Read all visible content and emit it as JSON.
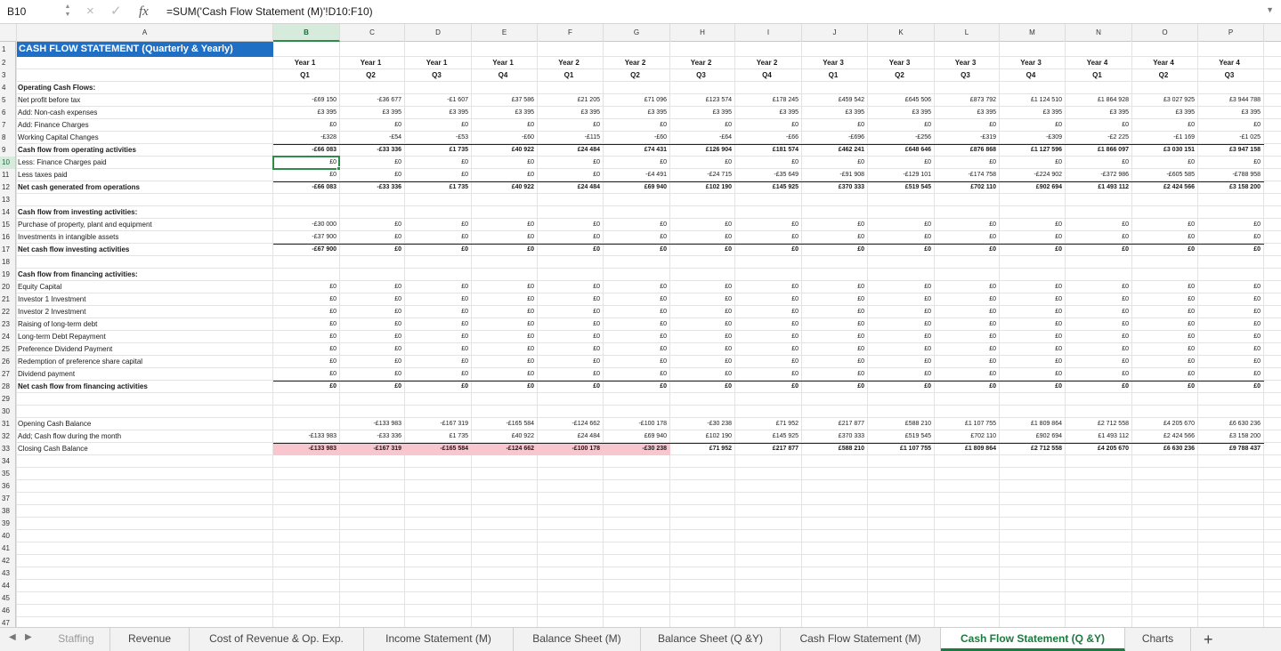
{
  "formula_bar": {
    "name_box": "B10",
    "cancel_icon": "×",
    "confirm_icon": "✓",
    "fx_label": "fx",
    "formula": "=SUM('Cash Flow Statement (M)'!D10:F10)"
  },
  "columns": [
    "A",
    "B",
    "C",
    "D",
    "E",
    "F",
    "G",
    "H",
    "I",
    "J",
    "K",
    "L",
    "M",
    "N",
    "O",
    "P"
  ],
  "title": "CASH FLOW STATEMENT (Quarterly & Yearly)",
  "header_years": [
    "Year 1",
    "Year 1",
    "Year 1",
    "Year 1",
    "Year 2",
    "Year 2",
    "Year 2",
    "Year 2",
    "Year 3",
    "Year 3",
    "Year 3",
    "Year 3",
    "Year 4",
    "Year 4",
    "Year 4"
  ],
  "header_quarters": [
    "Q1",
    "Q2",
    "Q3",
    "Q4",
    "Q1",
    "Q2",
    "Q3",
    "Q4",
    "Q1",
    "Q2",
    "Q3",
    "Q4",
    "Q1",
    "Q2",
    "Q3"
  ],
  "rows": [
    {
      "n": "4",
      "label": "Operating Cash Flows:",
      "bold": true,
      "values": []
    },
    {
      "n": "5",
      "label": "Net profit before tax",
      "bold": false,
      "values": [
        "-£69 150",
        "-£36 677",
        "-£1 607",
        "£37 586",
        "£21 205",
        "£71 096",
        "£123 574",
        "£178 245",
        "£459 542",
        "£645 506",
        "£873 792",
        "£1 124 510",
        "£1 864 928",
        "£3 027 925",
        "£3 944 788"
      ]
    },
    {
      "n": "6",
      "label": "Add: Non-cash expenses",
      "bold": false,
      "values": [
        "£3 395",
        "£3 395",
        "£3 395",
        "£3 395",
        "£3 395",
        "£3 395",
        "£3 395",
        "£3 395",
        "£3 395",
        "£3 395",
        "£3 395",
        "£3 395",
        "£3 395",
        "£3 395",
        "£3 395"
      ]
    },
    {
      "n": "7",
      "label": "Add: Finance Charges",
      "bold": false,
      "values": [
        "£0",
        "£0",
        "£0",
        "£0",
        "£0",
        "£0",
        "£0",
        "£0",
        "£0",
        "£0",
        "£0",
        "£0",
        "£0",
        "£0",
        "£0"
      ]
    },
    {
      "n": "8",
      "label": "Working Capital Changes",
      "bold": false,
      "values": [
        "-£328",
        "-£54",
        "-£53",
        "-£60",
        "-£115",
        "-£60",
        "-£64",
        "-£66",
        "-£696",
        "-£256",
        "-£319",
        "-£309",
        "-£2 225",
        "-£1 169",
        "-£1 025"
      ]
    },
    {
      "n": "9",
      "label": "Cash flow from operating activities",
      "bold": true,
      "values": [
        "-£66 083",
        "-£33 336",
        "£1 735",
        "£40 922",
        "£24 484",
        "£74 431",
        "£126 904",
        "£181 574",
        "£462 241",
        "£648 646",
        "£876 868",
        "£1 127 596",
        "£1 866 097",
        "£3 030 151",
        "£3 947 158"
      ]
    },
    {
      "n": "10",
      "label": "Less: Finance Charges paid",
      "bold": false,
      "values": [
        "£0",
        "£0",
        "£0",
        "£0",
        "£0",
        "£0",
        "£0",
        "£0",
        "£0",
        "£0",
        "£0",
        "£0",
        "£0",
        "£0",
        "£0"
      ]
    },
    {
      "n": "11",
      "label": "Less  taxes paid",
      "bold": false,
      "values": [
        "£0",
        "£0",
        "£0",
        "£0",
        "£0",
        "-£4 491",
        "-£24 715",
        "-£35 649",
        "-£91 908",
        "-£129 101",
        "-£174 758",
        "-£224 902",
        "-£372 986",
        "-£605 585",
        "-£788 958"
      ]
    },
    {
      "n": "12",
      "label": "Net cash generated from operations",
      "bold": true,
      "values": [
        "-£66 083",
        "-£33 336",
        "£1 735",
        "£40 922",
        "£24 484",
        "£69 940",
        "£102 190",
        "£145 925",
        "£370 333",
        "£519 545",
        "£702 110",
        "£902 694",
        "£1 493 112",
        "£2 424 566",
        "£3 158 200"
      ]
    },
    {
      "n": "13",
      "label": "",
      "bold": false,
      "values": []
    },
    {
      "n": "14",
      "label": "Cash flow from investing activities:",
      "bold": true,
      "values": []
    },
    {
      "n": "15",
      "label": "Purchase of property, plant and equipment",
      "bold": false,
      "values": [
        "-£30 000",
        "£0",
        "£0",
        "£0",
        "£0",
        "£0",
        "£0",
        "£0",
        "£0",
        "£0",
        "£0",
        "£0",
        "£0",
        "£0",
        "£0"
      ]
    },
    {
      "n": "16",
      "label": "Investments in intangible assets",
      "bold": false,
      "values": [
        "-£37 900",
        "£0",
        "£0",
        "£0",
        "£0",
        "£0",
        "£0",
        "£0",
        "£0",
        "£0",
        "£0",
        "£0",
        "£0",
        "£0",
        "£0"
      ]
    },
    {
      "n": "17",
      "label": "Net cash flow investing activities",
      "bold": true,
      "values": [
        "-£67 900",
        "£0",
        "£0",
        "£0",
        "£0",
        "£0",
        "£0",
        "£0",
        "£0",
        "£0",
        "£0",
        "£0",
        "£0",
        "£0",
        "£0"
      ]
    },
    {
      "n": "18",
      "label": "",
      "bold": false,
      "values": []
    },
    {
      "n": "19",
      "label": "Cash flow from financing activities:",
      "bold": true,
      "values": []
    },
    {
      "n": "20",
      "label": "Equity Capital",
      "bold": false,
      "values": [
        "£0",
        "£0",
        "£0",
        "£0",
        "£0",
        "£0",
        "£0",
        "£0",
        "£0",
        "£0",
        "£0",
        "£0",
        "£0",
        "£0",
        "£0"
      ]
    },
    {
      "n": "21",
      "label": "Investor 1 Investment",
      "bold": false,
      "values": [
        "£0",
        "£0",
        "£0",
        "£0",
        "£0",
        "£0",
        "£0",
        "£0",
        "£0",
        "£0",
        "£0",
        "£0",
        "£0",
        "£0",
        "£0"
      ]
    },
    {
      "n": "22",
      "label": "Investor 2 Investment",
      "bold": false,
      "values": [
        "£0",
        "£0",
        "£0",
        "£0",
        "£0",
        "£0",
        "£0",
        "£0",
        "£0",
        "£0",
        "£0",
        "£0",
        "£0",
        "£0",
        "£0"
      ]
    },
    {
      "n": "23",
      "label": "Raising of long-term debt",
      "bold": false,
      "values": [
        "£0",
        "£0",
        "£0",
        "£0",
        "£0",
        "£0",
        "£0",
        "£0",
        "£0",
        "£0",
        "£0",
        "£0",
        "£0",
        "£0",
        "£0"
      ]
    },
    {
      "n": "24",
      "label": "Long-term Debt Repayment",
      "bold": false,
      "values": [
        "£0",
        "£0",
        "£0",
        "£0",
        "£0",
        "£0",
        "£0",
        "£0",
        "£0",
        "£0",
        "£0",
        "£0",
        "£0",
        "£0",
        "£0"
      ]
    },
    {
      "n": "25",
      "label": "Preference Dividend Payment",
      "bold": false,
      "values": [
        "£0",
        "£0",
        "£0",
        "£0",
        "£0",
        "£0",
        "£0",
        "£0",
        "£0",
        "£0",
        "£0",
        "£0",
        "£0",
        "£0",
        "£0"
      ]
    },
    {
      "n": "26",
      "label": "Redemption of preference share capital",
      "bold": false,
      "values": [
        "£0",
        "£0",
        "£0",
        "£0",
        "£0",
        "£0",
        "£0",
        "£0",
        "£0",
        "£0",
        "£0",
        "£0",
        "£0",
        "£0",
        "£0"
      ]
    },
    {
      "n": "27",
      "label": "Dividend payment",
      "bold": false,
      "values": [
        "£0",
        "£0",
        "£0",
        "£0",
        "£0",
        "£0",
        "£0",
        "£0",
        "£0",
        "£0",
        "£0",
        "£0",
        "£0",
        "£0",
        "£0"
      ]
    },
    {
      "n": "28",
      "label": "Net cash flow from financing activities",
      "bold": true,
      "values": [
        "£0",
        "£0",
        "£0",
        "£0",
        "£0",
        "£0",
        "£0",
        "£0",
        "£0",
        "£0",
        "£0",
        "£0",
        "£0",
        "£0",
        "£0"
      ]
    },
    {
      "n": "29",
      "label": "",
      "bold": false,
      "values": []
    },
    {
      "n": "30",
      "label": "",
      "bold": false,
      "values": []
    },
    {
      "n": "31",
      "label": "Opening Cash Balance",
      "bold": false,
      "values": [
        "",
        "-£133 983",
        "-£167 319",
        "-£165 584",
        "-£124 662",
        "-£100 178",
        "-£30 238",
        "£71 952",
        "£217 877",
        "£588 210",
        "£1 107 755",
        "£1 809 864",
        "£2 712 558",
        "£4 205 670",
        "£6 630 236"
      ]
    },
    {
      "n": "32",
      "label": "Add; Cash flow during the month",
      "bold": false,
      "values": [
        "-£133 983",
        "-£33 336",
        "£1 735",
        "£40 922",
        "£24 484",
        "£69 940",
        "£102 190",
        "£145 925",
        "£370 333",
        "£519 545",
        "£702 110",
        "£902 694",
        "£1 493 112",
        "£2 424 566",
        "£3 158 200"
      ]
    },
    {
      "n": "33",
      "label": "Closing Cash Balance",
      "bold": false,
      "closing": true,
      "values": [
        "-£133 983",
        "-£167 319",
        "-£165 584",
        "-£124 662",
        "-£100 178",
        "-£30 238",
        "£71 952",
        "£217 877",
        "£588 210",
        "£1 107 755",
        "£1 809 864",
        "£2 712 558",
        "£4 205 670",
        "£6 630 236",
        "£9 788 437"
      ]
    },
    {
      "n": "34",
      "label": "",
      "bold": false,
      "values": []
    },
    {
      "n": "35",
      "label": "",
      "bold": false,
      "values": []
    },
    {
      "n": "36",
      "label": "",
      "bold": false,
      "values": []
    },
    {
      "n": "37",
      "label": "",
      "bold": false,
      "values": []
    },
    {
      "n": "38",
      "label": "",
      "bold": false,
      "values": []
    },
    {
      "n": "39",
      "label": "",
      "bold": false,
      "values": []
    },
    {
      "n": "40",
      "label": "",
      "bold": false,
      "values": []
    },
    {
      "n": "41",
      "label": "",
      "bold": false,
      "values": []
    },
    {
      "n": "42",
      "label": "",
      "bold": false,
      "values": []
    },
    {
      "n": "43",
      "label": "",
      "bold": false,
      "values": []
    },
    {
      "n": "44",
      "label": "",
      "bold": false,
      "values": []
    },
    {
      "n": "45",
      "label": "",
      "bold": false,
      "values": []
    },
    {
      "n": "46",
      "label": "",
      "bold": false,
      "values": []
    },
    {
      "n": "47",
      "label": "",
      "bold": false,
      "values": []
    }
  ],
  "closing_negative_color": "#f7c6cf",
  "sheet_tabs": [
    "Staffing",
    "Revenue",
    "Cost of Revenue & Op. Exp.",
    "Income Statement (M)",
    "Balance Sheet (M)",
    "Balance Sheet (Q &Y)",
    "Cash Flow Statement (M)",
    "Cash Flow Statement (Q &Y)",
    "Charts"
  ],
  "active_tab": "Cash Flow Statement (Q &Y)",
  "accent_color": "#1b7a3e",
  "title_color": "#1f6fc5"
}
